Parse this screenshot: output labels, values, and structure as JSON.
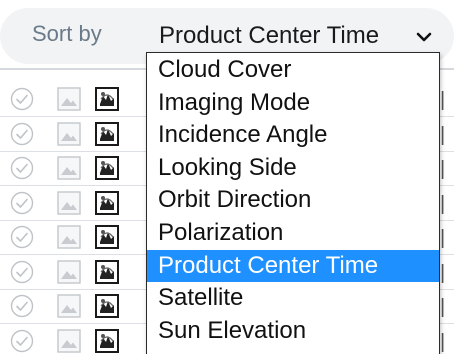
{
  "sort": {
    "label": "Sort by",
    "selected": "Product Center Time",
    "options": [
      "Cloud Cover",
      "Imaging Mode",
      "Incidence Angle",
      "Looking Side",
      "Orbit Direction",
      "Polarization",
      "Product Center Time",
      "Satellite",
      "Sun Elevation"
    ],
    "selected_index": 6
  },
  "list": {
    "row_count": 8
  },
  "colors": {
    "selected_option_bg": "#1e90ff",
    "sort_bar_bg": "#f1f3f5",
    "sort_label_color": "#6b7a88"
  }
}
